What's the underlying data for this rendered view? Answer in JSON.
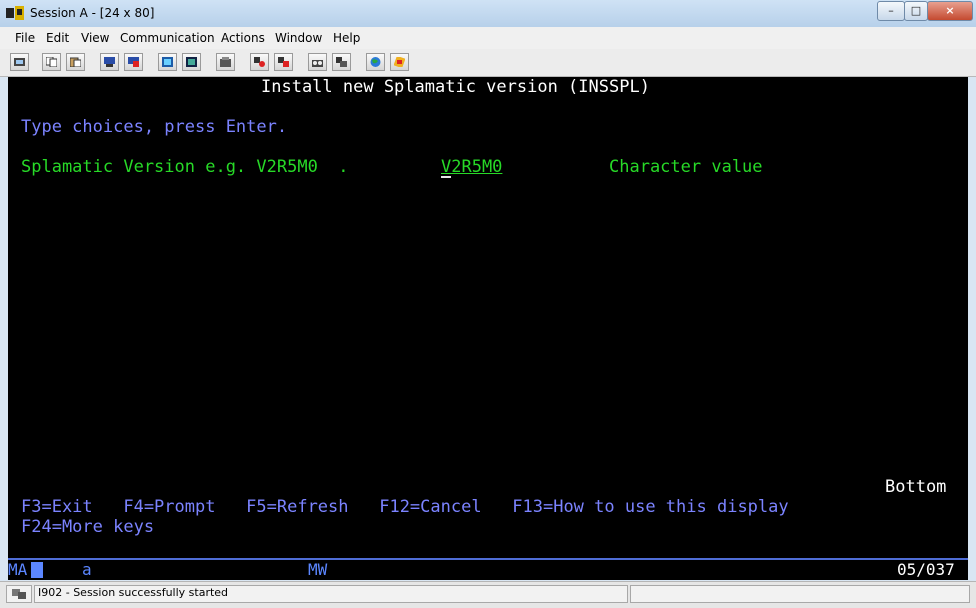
{
  "window": {
    "title": "Session A - [24 x 80]",
    "controls": [
      "–",
      "□",
      "×"
    ]
  },
  "menu": [
    "File",
    "Edit",
    "View",
    "Communication",
    "Actions",
    "Window",
    "Help"
  ],
  "toolbar": {
    "icons": [
      "print-screen-icon",
      "copy-icon",
      "paste-icon",
      "send-icon",
      "receive-icon",
      "display-icon",
      "keypad-icon",
      "macro-record-icon",
      "macro-play-icon",
      "macro-stop-icon",
      "macro-run-icon",
      "macro-edit-icon",
      "globe-icon",
      "help-icon"
    ]
  },
  "screen": {
    "title": "Install new Splamatic version (INSSPL)",
    "instruction": "Type choices, press Enter.",
    "field_label": "Splamatic Version e.g. V2R5M0  .",
    "field_value": "V2R5M0",
    "field_hint": "Character value",
    "scroll_indicator": "Bottom",
    "fkeys_line1": "F3=Exit   F4=Prompt   F5=Refresh   F12=Cancel   F13=How to use this display",
    "fkeys_line2": "F24=More keys"
  },
  "oia": {
    "mode": "MA",
    "field_a": "a",
    "field_mw": "MW",
    "cursor_position": "05/037"
  },
  "status": {
    "message": "I902 - Session successfully started"
  },
  "colors": {
    "screen_bg": "#000000",
    "white": "#ffffff",
    "blue": "#7b83ff",
    "green": "#27d927",
    "oia_rule": "#4f6dd6"
  }
}
